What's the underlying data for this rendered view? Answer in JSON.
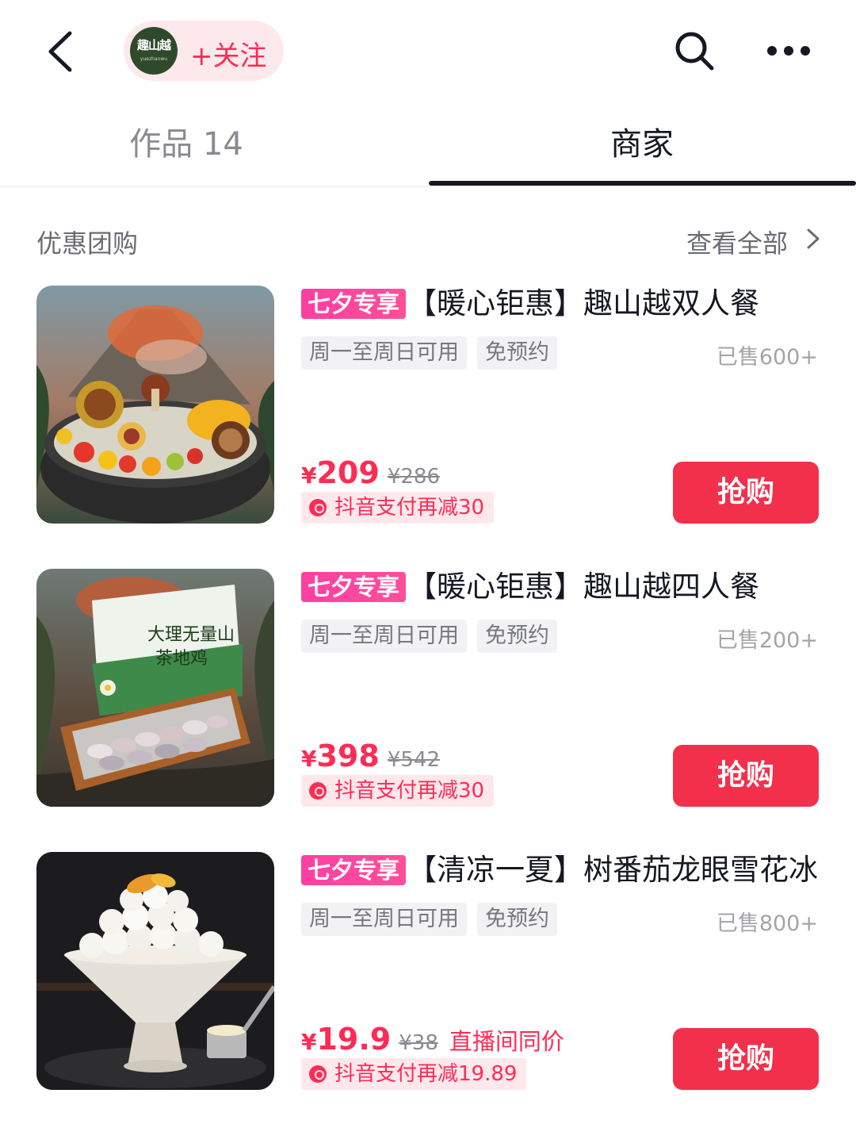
{
  "header": {
    "avatar_text": "趣山越",
    "avatar_sub": "yuezhanwu",
    "follow_label": "+关注"
  },
  "tabs": [
    {
      "label": "作品 14",
      "active": false
    },
    {
      "label": "商家",
      "active": true
    }
  ],
  "section": {
    "title": "优惠团购",
    "view_all": "查看全部"
  },
  "deals": [
    {
      "badge": "七夕专享",
      "title": "【暖心钜惠】趣山越双人餐",
      "tags": [
        "周一至周日可用",
        "免预约"
      ],
      "sold": "已售600+",
      "currency": "¥",
      "price": "209",
      "original_price": "¥286",
      "extra": "",
      "discount": "抖音支付再减30",
      "button": "抢购",
      "image": "hotpot-with-fruits-and-mushrooms"
    },
    {
      "badge": "七夕专享",
      "title": "【暖心钜惠】趣山越四人餐",
      "tags": [
        "周一至周日可用",
        "免预约"
      ],
      "sold": "已售200+",
      "currency": "¥",
      "price": "398",
      "original_price": "¥542",
      "extra": "",
      "discount": "抖音支付再减30",
      "button": "抢购",
      "image": "boxed-chicken-pieces",
      "box_text_line1": "大理无量山",
      "box_text_line2": "茶地鸡"
    },
    {
      "badge": "七夕专享",
      "title": "【清凉一夏】树番茄龙眼雪花冰",
      "tags": [
        "周一至周日可用",
        "免预约"
      ],
      "sold": "已售800+",
      "currency": "¥",
      "price": "19.9",
      "original_price": "¥38",
      "extra": "直播间同价",
      "discount": "抖音支付再减19.89",
      "button": "抢购",
      "image": "longan-shaved-ice-dessert"
    }
  ],
  "colors": {
    "accent": "#fe2c55",
    "badge": "#ff3fa1",
    "button": "#f2304c"
  }
}
